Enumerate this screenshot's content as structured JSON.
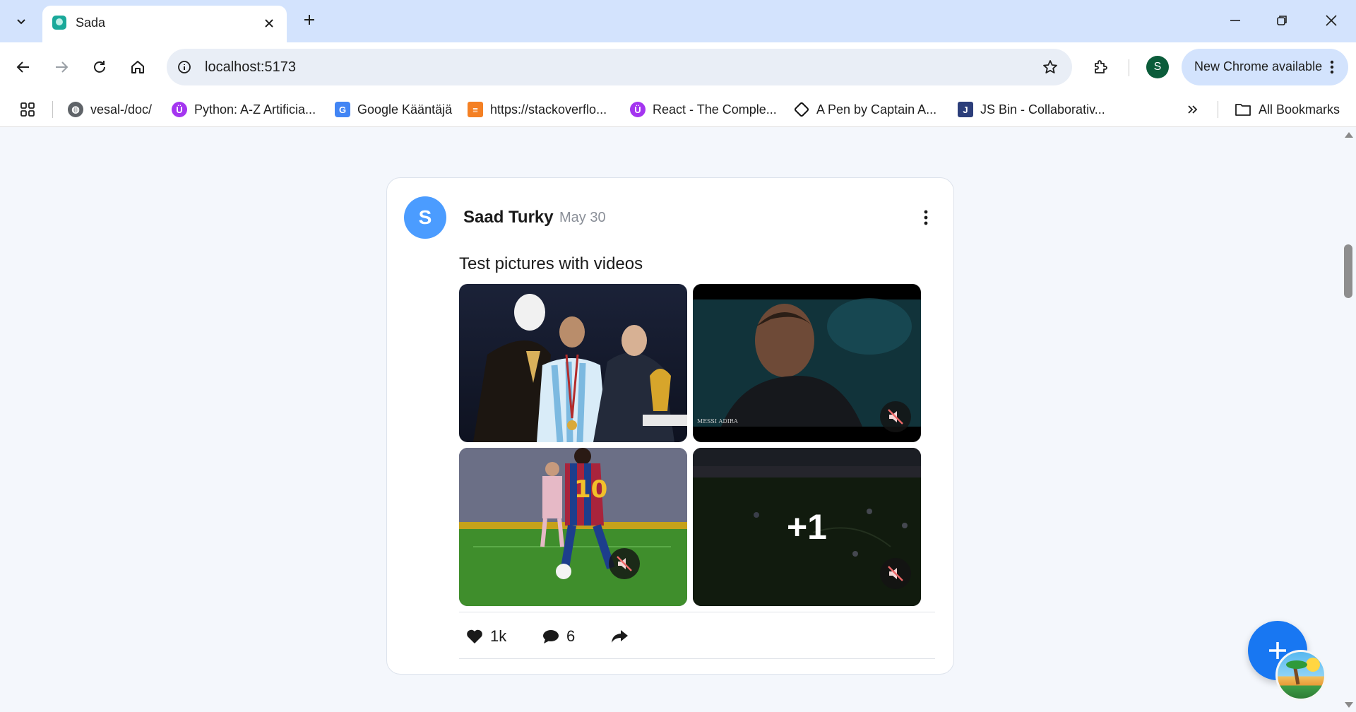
{
  "browser": {
    "tab_title": "Sada",
    "url": "localhost:5173",
    "update_label": "New Chrome available",
    "profile_initial": "S",
    "bookmarks": [
      {
        "label": "vesal-/doc/",
        "icon": "globe-icon",
        "color": "#5f6368"
      },
      {
        "label": "Python: A-Z Artificia...",
        "icon": "udemy-icon",
        "color": "#a435f0"
      },
      {
        "label": "Google Kääntäjä",
        "icon": "google-translate-icon",
        "color": "#4285f4"
      },
      {
        "label": "https://stackoverflo...",
        "icon": "stackoverflow-icon",
        "color": "#f48024"
      },
      {
        "label": "React - The Comple...",
        "icon": "udemy-icon",
        "color": "#a435f0"
      },
      {
        "label": "A Pen by Captain A...",
        "icon": "codepen-icon",
        "color": "#111111"
      },
      {
        "label": "JS Bin - Collaborativ...",
        "icon": "jsbin-icon",
        "color": "#2c3e7a"
      }
    ],
    "all_bookmarks_label": "All Bookmarks"
  },
  "post": {
    "avatar_initial": "S",
    "author": "Saad Turky",
    "date": "May 30",
    "text": "Test pictures with videos",
    "media": [
      {
        "kind": "image",
        "description_icon": "photo-icon"
      },
      {
        "kind": "video",
        "muted": true,
        "watermark": "MESSI ADIRA"
      },
      {
        "kind": "video",
        "muted": true
      },
      {
        "kind": "video",
        "muted": true,
        "overlay": "+1"
      }
    ],
    "actions": {
      "likes": "1k",
      "comments": "6"
    }
  },
  "colors": {
    "accent": "#1877f2",
    "avatar": "#4b9cff",
    "chrome_tabbar": "#d3e3fd"
  }
}
